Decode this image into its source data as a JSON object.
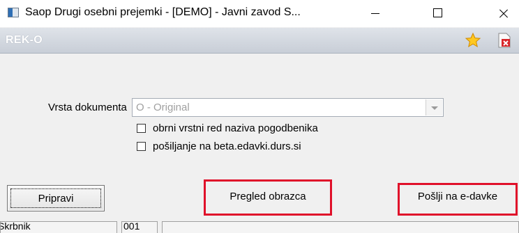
{
  "window": {
    "title": "Saop  Drugi osebni prejemki  -  [DEMO] - Javni zavod S..."
  },
  "header": {
    "title": "REK-O"
  },
  "form": {
    "doc_type_label": "Vrsta dokumenta",
    "doc_type_value": "O - Original",
    "checkboxes": [
      {
        "label": "obrni vrstni red naziva pogodbenika",
        "checked": false
      },
      {
        "label": "pošiljanje na beta.edavki.durs.si",
        "checked": false
      }
    ]
  },
  "buttons": {
    "prepare": "Pripravi",
    "preview": "Pregled obrazca",
    "send": "Pošlji na e-davke"
  },
  "status": {
    "user": "Skrbnik",
    "code": "001",
    "extra": ""
  },
  "colors": {
    "highlight": "#e0102a",
    "header_gradient_top": "#dfe3e9",
    "header_gradient_bottom": "#c8ced7"
  },
  "icons": [
    "app-icon",
    "minimize-icon",
    "maximize-icon",
    "close-icon",
    "star-icon",
    "close-document-icon",
    "dropdown-arrow-icon"
  ]
}
